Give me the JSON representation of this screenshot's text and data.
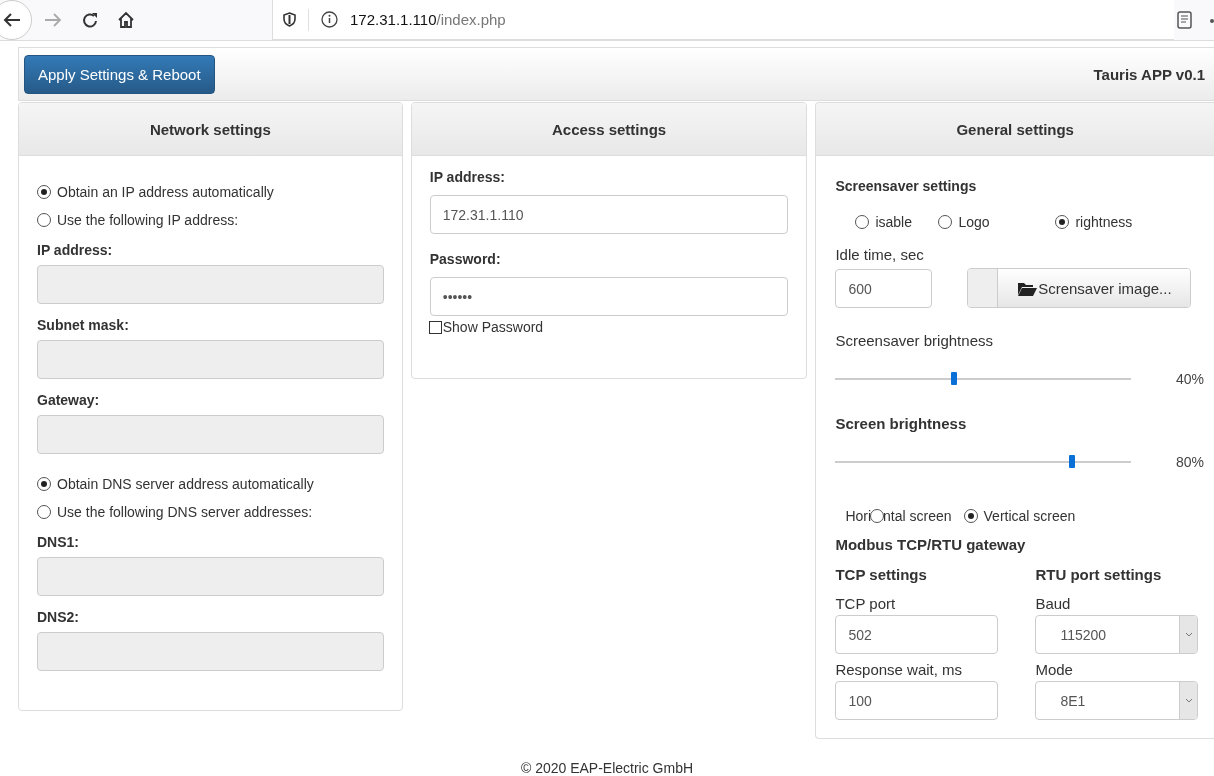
{
  "browser": {
    "url_host": "172.31.1.110",
    "url_path": "/index.php"
  },
  "header": {
    "button": "Apply Settings & Reboot",
    "app_title": "Tauris APP v0.1"
  },
  "network": {
    "title": "Network settings",
    "ip_mode": [
      {
        "label": "Obtain an IP address automatically",
        "selected": true
      },
      {
        "label": "Use the following IP address:",
        "selected": false
      }
    ],
    "ip_fields": [
      {
        "label": "IP address:",
        "disabled": true
      },
      {
        "label": "Subnet mask:",
        "disabled": true
      },
      {
        "label": "Gateway:",
        "disabled": true
      }
    ],
    "dns_mode": [
      {
        "label": "Obtain DNS server address automatically",
        "selected": true
      },
      {
        "label": "Use the following DNS server addresses:",
        "selected": false
      }
    ],
    "dns_fields": [
      {
        "label": "DNS1:",
        "disabled": true
      },
      {
        "label": "DNS2:",
        "disabled": true
      }
    ]
  },
  "access": {
    "title": "Access settings",
    "fields": [
      {
        "label": "IP address:",
        "value": "172.31.1.110"
      },
      {
        "label": "Password:",
        "value": "••••••"
      }
    ],
    "show_password": {
      "label": "Show Password",
      "checked": false
    }
  },
  "general": {
    "title": "General settings",
    "screensaver": {
      "heading": "Screensaver settings",
      "modes": [
        {
          "label": "isable",
          "selected": false
        },
        {
          "label": "Logo",
          "selected": false
        },
        {
          "label": "rightness",
          "selected": true
        }
      ],
      "idle": {
        "label": "Idle time, sec",
        "value": "600"
      },
      "image_button": "Scrensaver image...",
      "brightness": {
        "label": "Screensaver brightness",
        "level": 0.4,
        "reading": "40%"
      }
    },
    "screen_brightness": {
      "label": "Screen brightness",
      "level": 0.8,
      "reading": "80%"
    },
    "orientation": [
      {
        "label_before": "Hori",
        "label": "ntal screen",
        "selected": false
      },
      {
        "label": "Vertical screen",
        "selected": true
      }
    ],
    "modbus": {
      "heading": "Modbus TCP/RTU gateway",
      "columns": [
        {
          "heading": "TCP settings",
          "fields": [
            {
              "kind": "input",
              "label": "TCP port",
              "value": "502"
            },
            {
              "kind": "input",
              "label": "Response wait, ms",
              "value": "100"
            }
          ]
        },
        {
          "heading": "RTU port settings",
          "fields": [
            {
              "kind": "select",
              "label": "Baud",
              "value": "115200"
            },
            {
              "kind": "select",
              "label": "Mode",
              "value": "8E1"
            }
          ]
        }
      ]
    }
  },
  "footer": "© 2020 EAP-Electric GmbH"
}
